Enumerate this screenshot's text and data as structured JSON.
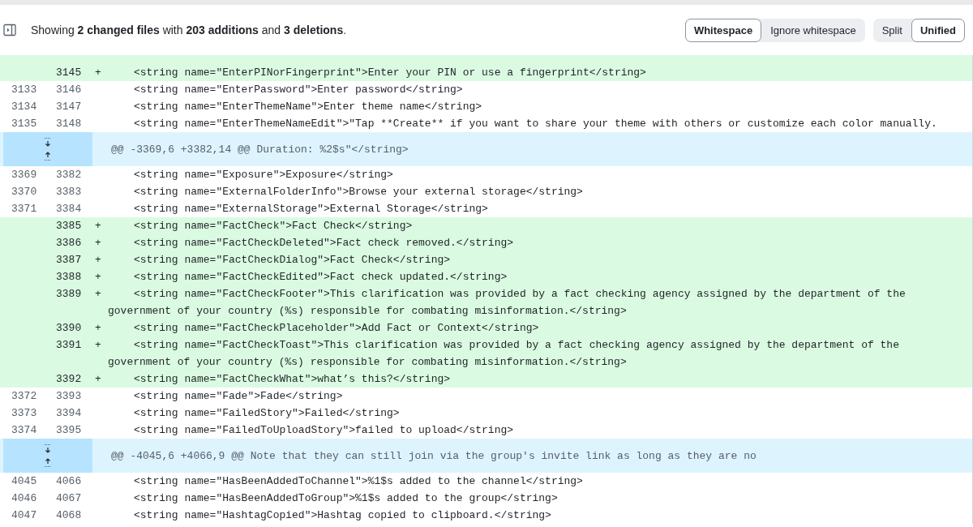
{
  "summary": "Showing **2 changed files** with **203 additions** and **3 deletions**.",
  "toggle_groups": [
    {
      "options": [
        {
          "label": "Whitespace",
          "selected": true
        },
        {
          "label": "Ignore whitespace",
          "selected": false
        }
      ]
    },
    {
      "options": [
        {
          "label": "Split",
          "selected": false
        },
        {
          "label": "Unified",
          "selected": true
        }
      ]
    }
  ],
  "diff": {
    "rows": [
      {
        "kind": "add",
        "new": "3145",
        "marker": "+",
        "code": "<string name=\"EnterPINorFingerprint\">Enter your PIN or use a fingerprint</string>"
      },
      {
        "kind": "context",
        "old": "3133",
        "new": "3146",
        "code": "<string name=\"EnterPassword\">Enter password</string>"
      },
      {
        "kind": "context",
        "old": "3134",
        "new": "3147",
        "code": "<string name=\"EnterThemeName\">Enter theme name</string>"
      },
      {
        "kind": "context",
        "old": "3135",
        "new": "3148",
        "code": "<string name=\"EnterThemeNameEdit\">\"Tap **Create** if you want to share your theme with others or customize each color manually."
      },
      {
        "kind": "hunk",
        "code": "@@ -3369,6 +3382,14 @@ Duration: %2$s\"</string>"
      },
      {
        "kind": "context",
        "old": "3369",
        "new": "3382",
        "code": "<string name=\"Exposure\">Exposure</string>"
      },
      {
        "kind": "context",
        "old": "3370",
        "new": "3383",
        "code": "<string name=\"ExternalFolderInfo\">Browse your external storage</string>"
      },
      {
        "kind": "context",
        "old": "3371",
        "new": "3384",
        "code": "<string name=\"ExternalStorage\">External Storage</string>"
      },
      {
        "kind": "add",
        "new": "3385",
        "marker": "+",
        "code": "<string name=\"FactCheck\">Fact Check</string>"
      },
      {
        "kind": "add",
        "new": "3386",
        "marker": "+",
        "code": "<string name=\"FactCheckDeleted\">Fact check removed.</string>"
      },
      {
        "kind": "add",
        "new": "3387",
        "marker": "+",
        "code": "<string name=\"FactCheckDialog\">Fact Check</string>"
      },
      {
        "kind": "add",
        "new": "3388",
        "marker": "+",
        "code": "<string name=\"FactCheckEdited\">Fact check updated.</string>"
      },
      {
        "kind": "add",
        "new": "3389",
        "marker": "+",
        "code": "<string name=\"FactCheckFooter\">This clarification was provided by a fact checking agency assigned by the department of the government of your country (%s) responsible for combating misinformation.</string>"
      },
      {
        "kind": "add",
        "new": "3390",
        "marker": "+",
        "code": "<string name=\"FactCheckPlaceholder\">Add Fact or Context</string>"
      },
      {
        "kind": "add",
        "new": "3391",
        "marker": "+",
        "code": "<string name=\"FactCheckToast\">This clarification was provided by a fact checking agency assigned by the department of the government of your country (%s) responsible for combating misinformation.</string>"
      },
      {
        "kind": "add",
        "new": "3392",
        "marker": "+",
        "code": "<string name=\"FactCheckWhat\">what’s this?</string>"
      },
      {
        "kind": "context",
        "old": "3372",
        "new": "3393",
        "code": "<string name=\"Fade\">Fade</string>"
      },
      {
        "kind": "context",
        "old": "3373",
        "new": "3394",
        "code": "<string name=\"FailedStory\">Failed</string>"
      },
      {
        "kind": "context",
        "old": "3374",
        "new": "3395",
        "code": "<string name=\"FailedToUploadStory\">failed to upload</string>"
      },
      {
        "kind": "hunk",
        "code": "@@ -4045,6 +4066,9 @@ Note that they can still join via the group's invite link as long as they are no"
      },
      {
        "kind": "context",
        "old": "4045",
        "new": "4066",
        "code": "<string name=\"HasBeenAddedToChannel\">%1$s added to the channel</string>"
      },
      {
        "kind": "context",
        "old": "4046",
        "new": "4067",
        "code": "<string name=\"HasBeenAddedToGroup\">%1$s added to the group</string>"
      },
      {
        "kind": "context",
        "old": "4047",
        "new": "4068",
        "code": "<string name=\"HashtagCopied\">Hashtag copied to clipboard.</string>"
      }
    ]
  }
}
